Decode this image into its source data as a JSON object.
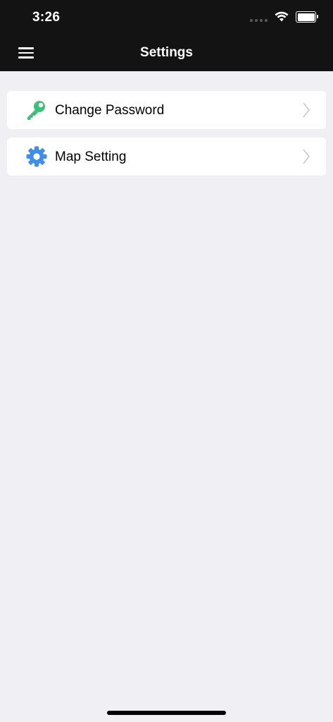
{
  "status_bar": {
    "time": "3:26"
  },
  "nav": {
    "title": "Settings",
    "menu_icon": "hamburger-menu-icon"
  },
  "settings": {
    "items": [
      {
        "label": "Change Password",
        "icon": "key-icon",
        "icon_color": "#3dbf7a"
      },
      {
        "label": "Map Setting",
        "icon": "gear-icon",
        "icon_color": "#3f8ee8"
      }
    ]
  },
  "colors": {
    "header_background": "#131313",
    "page_background": "#efeff4",
    "row_background": "#ffffff",
    "chevron": "#c7c7cc"
  }
}
